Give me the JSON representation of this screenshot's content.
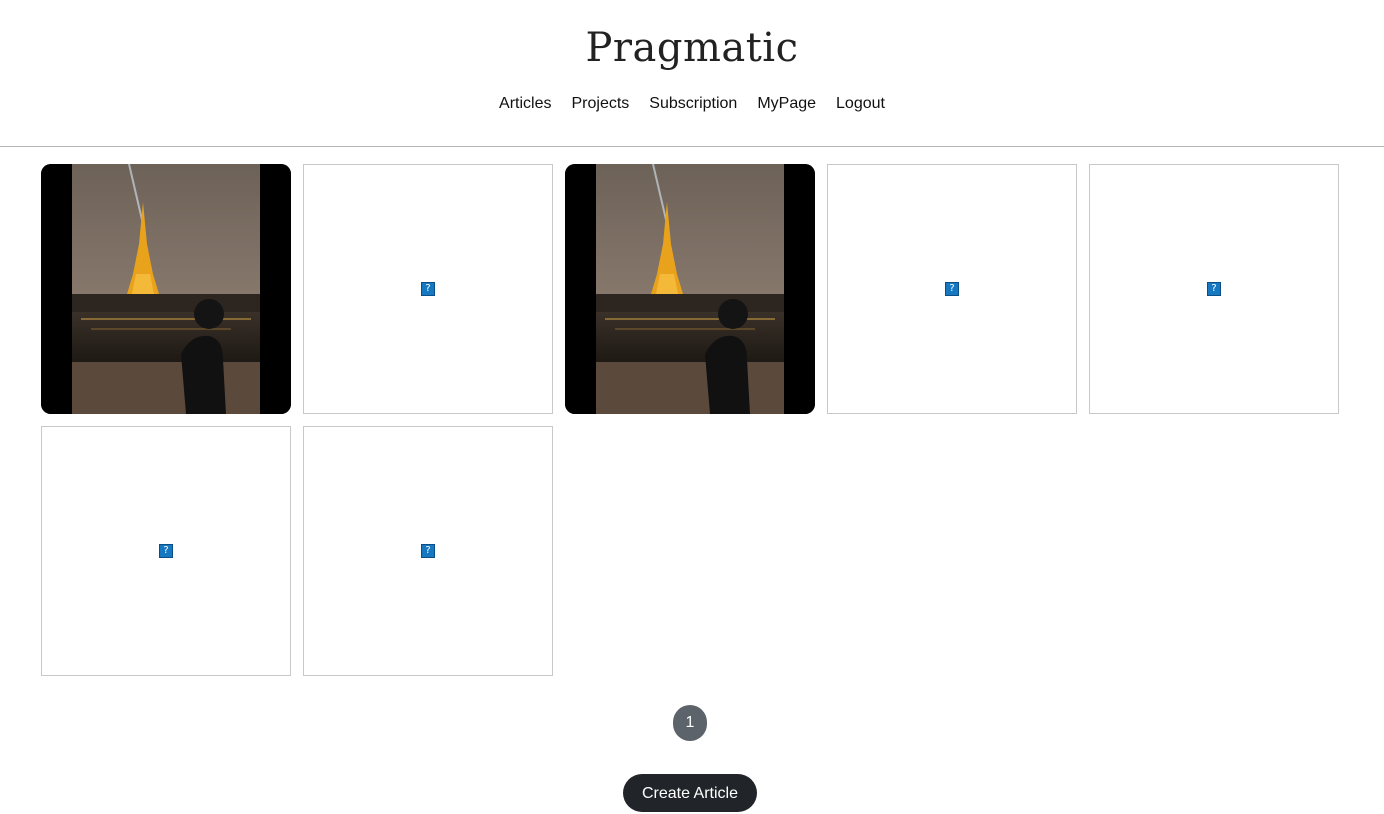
{
  "header": {
    "logo": "Pragmatic",
    "nav": [
      "Articles",
      "Projects",
      "Subscription",
      "MyPage",
      "Logout"
    ]
  },
  "articles": [
    {
      "kind": "photo",
      "icon": "eiffel-tower-photo"
    },
    {
      "kind": "broken",
      "icon": "broken-image-icon",
      "glyph": "?"
    },
    {
      "kind": "photo",
      "icon": "eiffel-tower-photo"
    },
    {
      "kind": "broken",
      "icon": "broken-image-icon",
      "glyph": "?"
    },
    {
      "kind": "broken",
      "icon": "broken-image-icon",
      "glyph": "?"
    },
    {
      "kind": "broken",
      "icon": "broken-image-icon",
      "glyph": "?"
    },
    {
      "kind": "broken",
      "icon": "broken-image-icon",
      "glyph": "?"
    }
  ],
  "pagination": {
    "current_page": "1"
  },
  "actions": {
    "create_label": "Create Article"
  }
}
